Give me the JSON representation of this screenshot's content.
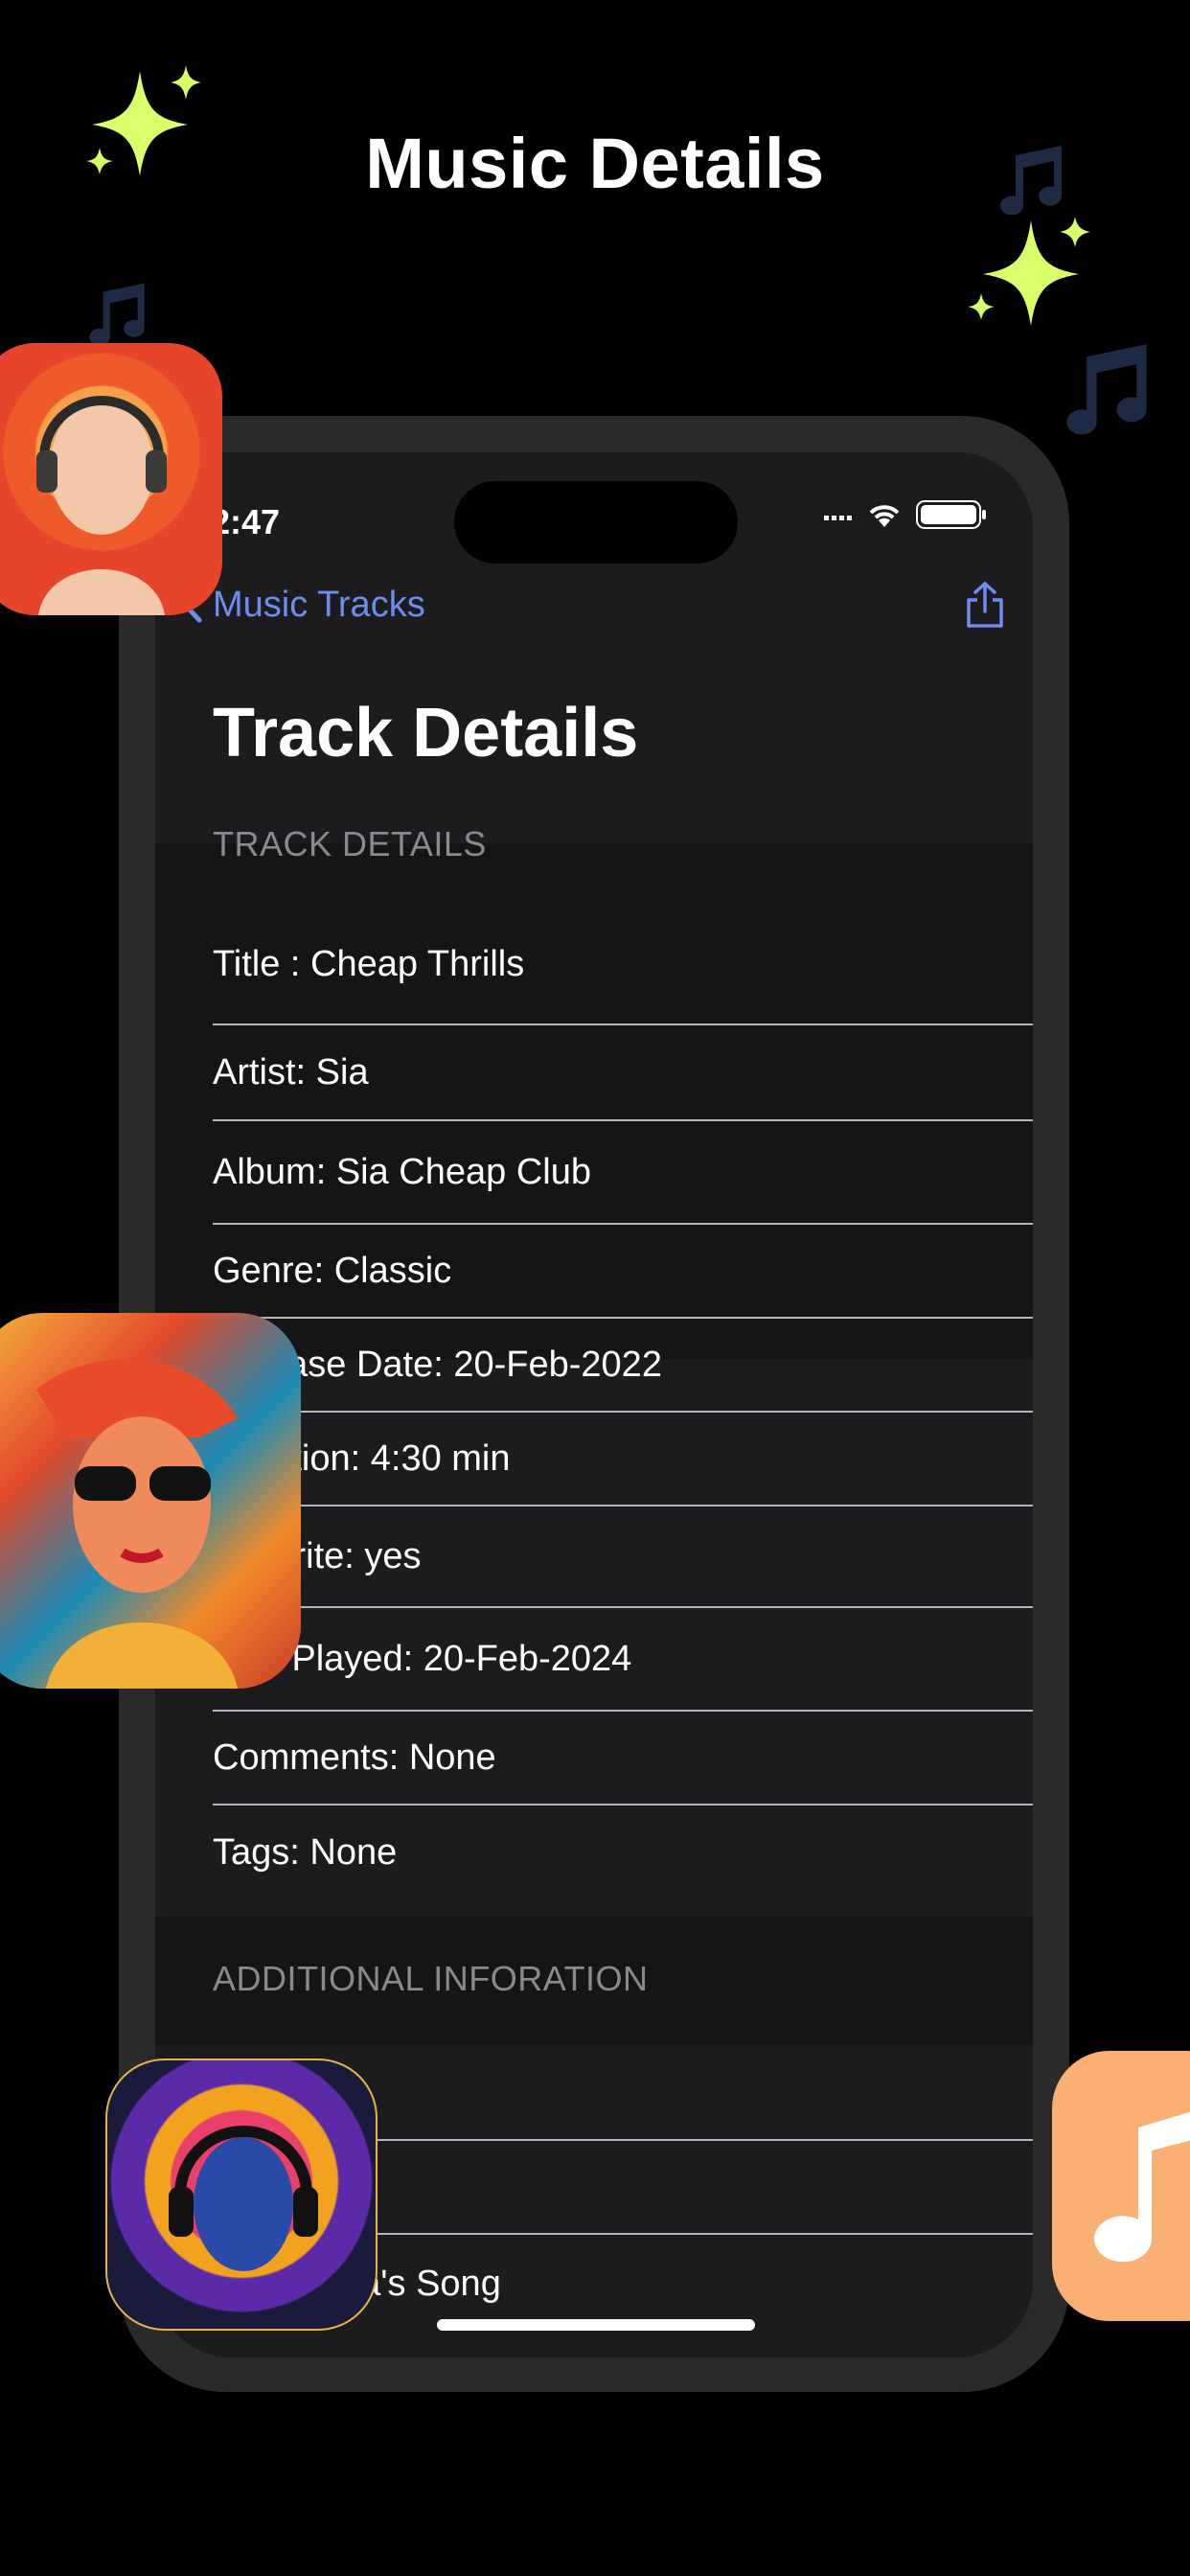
{
  "promo": {
    "title": "Music Details"
  },
  "status_bar": {
    "time": "2:47"
  },
  "nav": {
    "back_label": "Music Tracks"
  },
  "page": {
    "title": "Track Details"
  },
  "sections": {
    "track_details_header": "TRACK DETAILS",
    "additional_header": "ADDITIONAL INFORATION"
  },
  "track_rows": [
    "Title : Cheap Thrills",
    "Artist: Sia",
    "Album: Sia Cheap Club",
    "Genre: Classic",
    "Release Date: 20-Feb-2022",
    "Duration: 4:30 min",
    "Favorite: yes",
    "Last Played: 20-Feb-2024",
    "Comments: None",
    "Tags: None"
  ],
  "additional_rows": [
    "",
    "",
    "This is Sia's Song"
  ],
  "colors": {
    "accent": "#6e8cf0",
    "sparkle": "#d9ff6a",
    "note": "#1f2a44",
    "music_badge": "#f9b072"
  },
  "icons": {
    "back": "chevron-left-icon",
    "share": "share-icon",
    "music_badge": "music-note-icon"
  }
}
